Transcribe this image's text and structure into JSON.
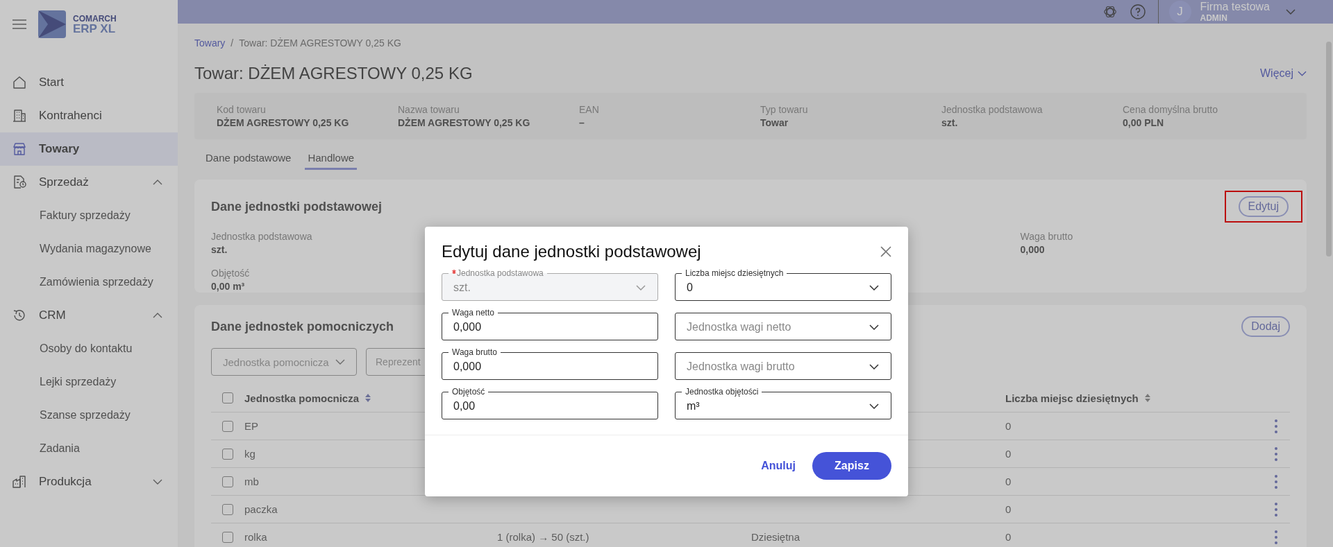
{
  "sidebar": {
    "logo": {
      "line1": "COMARCH",
      "line2": "ERP XL"
    },
    "items": [
      {
        "label": "Start",
        "selected": false
      },
      {
        "label": "Kontrahenci",
        "selected": false
      },
      {
        "label": "Towary",
        "selected": true
      },
      {
        "label": "Sprzedaż",
        "selected": false,
        "expanded": true,
        "children": [
          {
            "label": "Faktury sprzedaży",
            "selected": false
          },
          {
            "label": "Wydania magazynowe",
            "selected": false
          },
          {
            "label": "Zamówienia sprzedaży",
            "selected": false
          }
        ]
      },
      {
        "label": "CRM",
        "selected": false,
        "expanded": true,
        "children": [
          {
            "label": "Osoby do kontaktu",
            "selected": false
          },
          {
            "label": "Lejki sprzedaży",
            "selected": false
          },
          {
            "label": "Szanse sprzedaży",
            "selected": false
          },
          {
            "label": "Zadania",
            "selected": false
          }
        ]
      },
      {
        "label": "Produkcja",
        "selected": false,
        "expanded": false
      }
    ]
  },
  "header": {
    "user": {
      "initial": "J",
      "name": "Firma testowa",
      "role": "ADMIN"
    }
  },
  "breadcrumb": [
    "Towary",
    "Towar: DŻEM AGRESTOWY 0,25 KG"
  ],
  "breadcrumb_separator": "/",
  "title": "Towar: DŻEM AGRESTOWY 0,25 KG",
  "more_button": "Więcej",
  "summary": [
    {
      "label": "Kod towaru",
      "value": "DŻEM AGRESTOWY 0,25 KG"
    },
    {
      "label": "Nazwa towaru",
      "value": "DŻEM AGRESTOWY 0,25 KG"
    },
    {
      "label": "EAN",
      "value": "–"
    },
    {
      "label": "Typ towaru",
      "value": "Towar"
    },
    {
      "label": "Jednostka podstawowa",
      "value": "szt."
    },
    {
      "label": "Cena domyślna brutto",
      "value": "0,00 PLN"
    }
  ],
  "tabs": [
    {
      "label": "Dane podstawowe",
      "selected": false
    },
    {
      "label": "Handlowe",
      "selected": true
    }
  ],
  "basic_unit": {
    "title": "Dane jednostki podstawowej",
    "edit_button": {
      "label": "Edytuj",
      "highlighted": true
    },
    "fields": [
      {
        "label": "Jednostka podstawowa",
        "value": "szt."
      },
      {
        "label": "Waga brutto",
        "value": "0,000"
      },
      {
        "label": "Objętość",
        "value": "0,00 m³"
      }
    ]
  },
  "aux_units": {
    "title": "Dane jednostek pomocniczych",
    "add_button": "Dodaj",
    "filters": [
      {
        "placeholder": "Jednostka pomocnicza"
      },
      {
        "placeholder": "Reprezent"
      }
    ],
    "select_all_checked": false,
    "columns": {
      "unit": "Jednostka pomocnicza",
      "decimals": "Liczba miejsc dziesiętnych"
    },
    "rows": [
      {
        "checked": false,
        "unit": "EP",
        "decimals": "0"
      },
      {
        "checked": false,
        "unit": "kg",
        "decimals": "0"
      },
      {
        "checked": false,
        "unit": "mb",
        "decimals": "0"
      },
      {
        "checked": false,
        "unit": "paczka",
        "decimals": "0"
      },
      {
        "checked": false,
        "unit": "rolka",
        "column_2": "1 (rolka) → 50 (szt.)",
        "column_3": "Dziesiętna",
        "decimals": "0"
      }
    ]
  },
  "dialog": {
    "title": "Edytuj dane jednostki podstawowej",
    "fields": [
      {
        "kind": "select",
        "label": "Jednostka podstawowa",
        "required": true,
        "disabled": true,
        "value": "szt."
      },
      {
        "kind": "select",
        "label": "Liczba miejsc dziesiętnych",
        "required": false,
        "disabled": false,
        "value": "0"
      },
      {
        "kind": "input",
        "label": "Waga netto",
        "required": false,
        "disabled": false,
        "value": "0,000"
      },
      {
        "kind": "select",
        "required": false,
        "disabled": false,
        "placeholder": "Jednostka wagi netto"
      },
      {
        "kind": "input",
        "label": "Waga brutto",
        "required": false,
        "disabled": false,
        "value": "0,000"
      },
      {
        "kind": "select",
        "required": false,
        "disabled": false,
        "placeholder": "Jednostka wagi brutto"
      },
      {
        "kind": "input",
        "label": "Objętość",
        "required": false,
        "disabled": false,
        "value": "0,00"
      },
      {
        "kind": "select",
        "label": "Jednostka objętości",
        "required": false,
        "disabled": false,
        "value": "m³"
      }
    ],
    "cancel": "Anuluj",
    "save": "Zapisz"
  }
}
